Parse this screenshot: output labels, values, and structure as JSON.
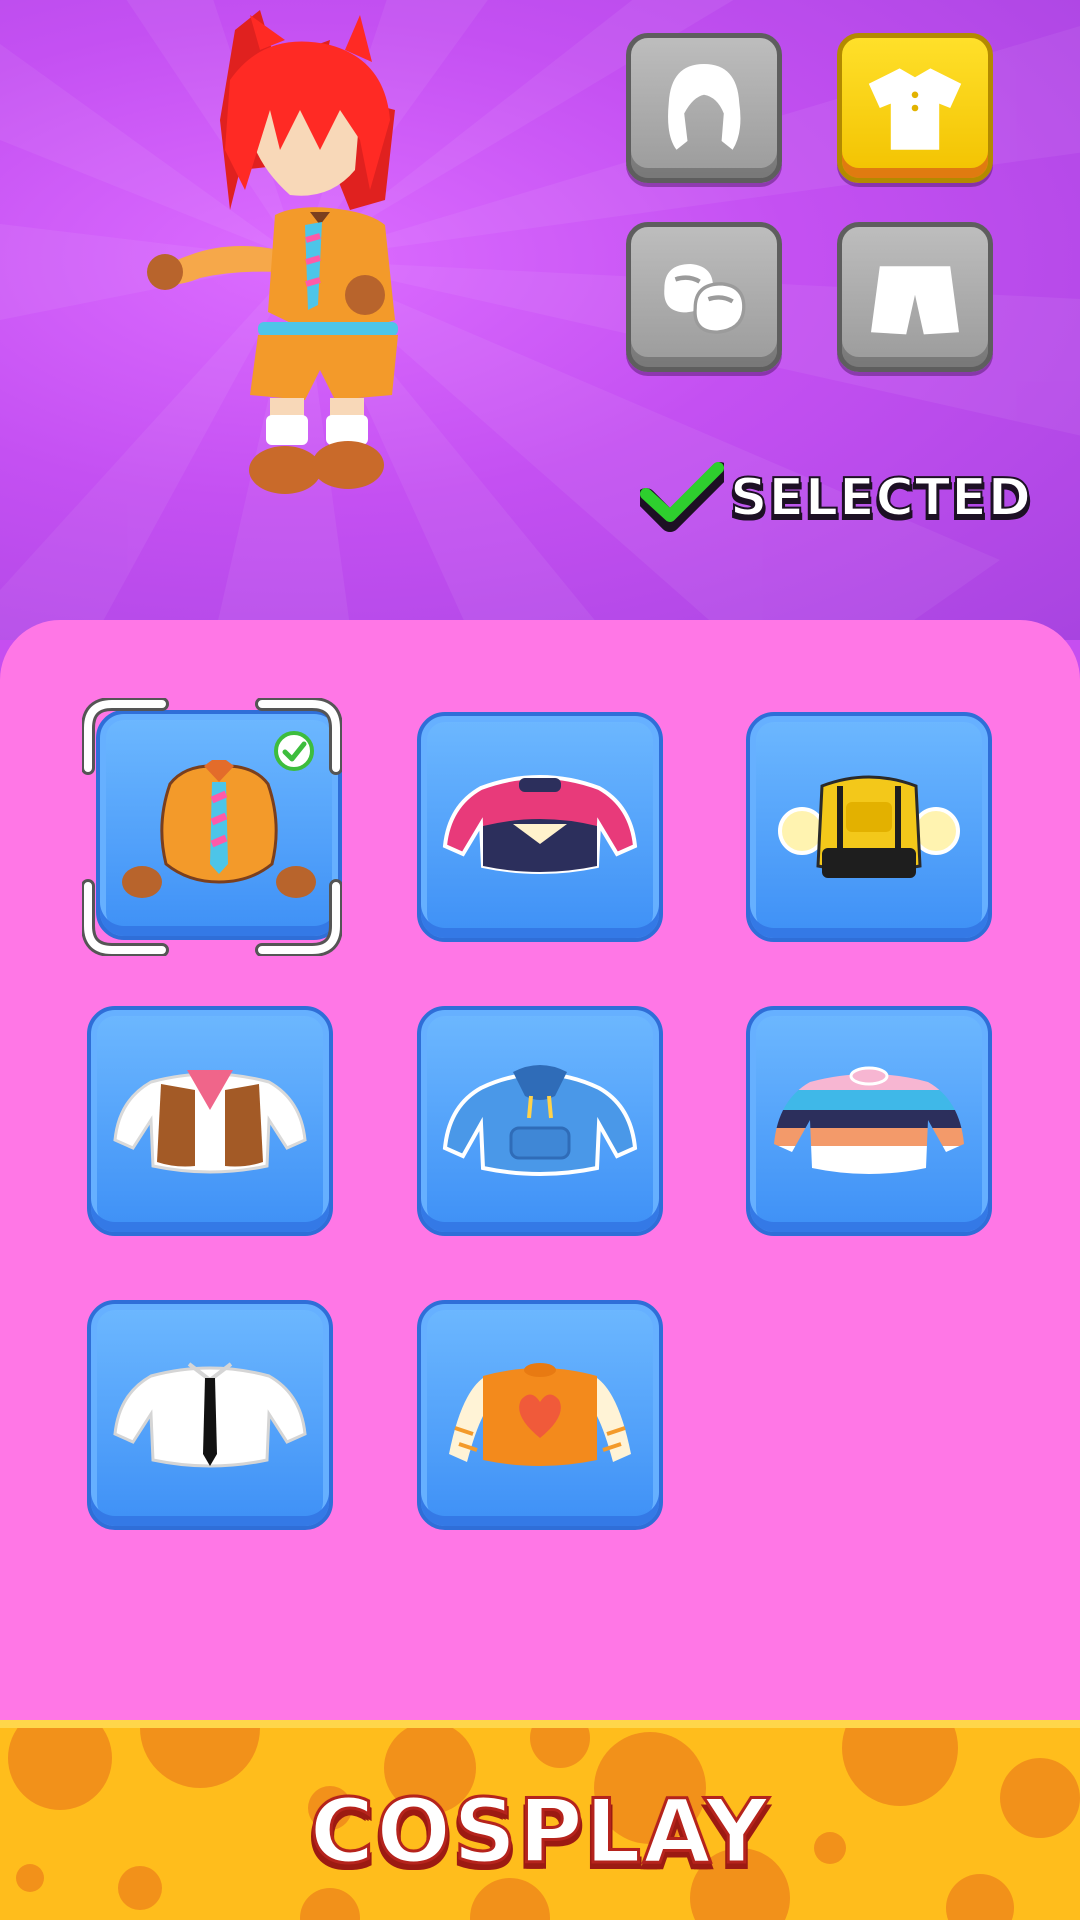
{
  "header": {
    "category_tabs": [
      {
        "name": "hair",
        "icon": "hair-icon",
        "active": false
      },
      {
        "name": "top",
        "icon": "shirt-icon",
        "active": true
      },
      {
        "name": "shoes",
        "icon": "shoes-icon",
        "active": false
      },
      {
        "name": "bottom",
        "icon": "shorts-icon",
        "active": false
      }
    ],
    "status_label": "SELECTED",
    "status_icon": "checkmark-icon"
  },
  "outfit_grid": {
    "items": [
      {
        "icon": "orange-vest-tie-outfit-icon",
        "selected": true
      },
      {
        "icon": "pink-crop-sweater-icon",
        "selected": false
      },
      {
        "icon": "yellow-backpack-jacket-icon",
        "selected": false
      },
      {
        "icon": "cowboy-vest-shirt-icon",
        "selected": false
      },
      {
        "icon": "blue-hoodie-icon",
        "selected": false
      },
      {
        "icon": "striped-sweater-icon",
        "selected": false
      },
      {
        "icon": "white-shirt-black-tie-icon",
        "selected": false
      },
      {
        "icon": "orange-heart-tee-icon",
        "selected": false
      }
    ]
  },
  "footer": {
    "button_label": "COSPLAY"
  },
  "colors": {
    "background_purple": "#c450f2",
    "panel_pink": "#ff77e6",
    "item_blue": "#3e90f6",
    "active_tab_yellow": "#ffe02a",
    "banner_orange": "#ffbd1c",
    "check_green": "#2ecf2e"
  }
}
